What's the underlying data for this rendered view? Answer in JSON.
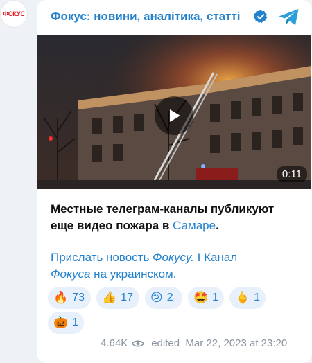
{
  "channel": {
    "avatar_text": "ФОКУС",
    "name": "Фокус: новини, аналітика, статті"
  },
  "video": {
    "duration": "0:11"
  },
  "message": {
    "text_before_link": "Местные телеграм-каналы публикуют еще видео пожара в ",
    "link_city": "Самаре",
    "text_after_link": ".",
    "link_send_news": "Прислать новость ",
    "link_send_news_italic": "Фокусу.",
    "separator": " I ",
    "link_channel": "Канал ",
    "link_channel_italic": "Фокуса",
    "link_channel_tail": " на украинском."
  },
  "reactions": [
    {
      "emoji": "🔥",
      "icon": "fire-icon",
      "count": "73"
    },
    {
      "emoji": "👍",
      "icon": "thumbs-up-icon",
      "count": "17"
    },
    {
      "emoji": "😢",
      "icon": "crying-face-icon",
      "count": "2"
    },
    {
      "emoji": "🤩",
      "icon": "star-struck-icon",
      "count": "1"
    },
    {
      "emoji": "🖕",
      "icon": "middle-finger-icon",
      "count": "1"
    },
    {
      "emoji": "🎃",
      "icon": "pumpkin-icon",
      "count": "1"
    }
  ],
  "footer": {
    "views": "4.64K",
    "edited_label": "edited",
    "date": "Mar 22, 2023 at 23:20"
  },
  "colors": {
    "accent": "#2481cc",
    "brand_red": "#e30613",
    "reaction_bg": "#e8f1fb"
  }
}
